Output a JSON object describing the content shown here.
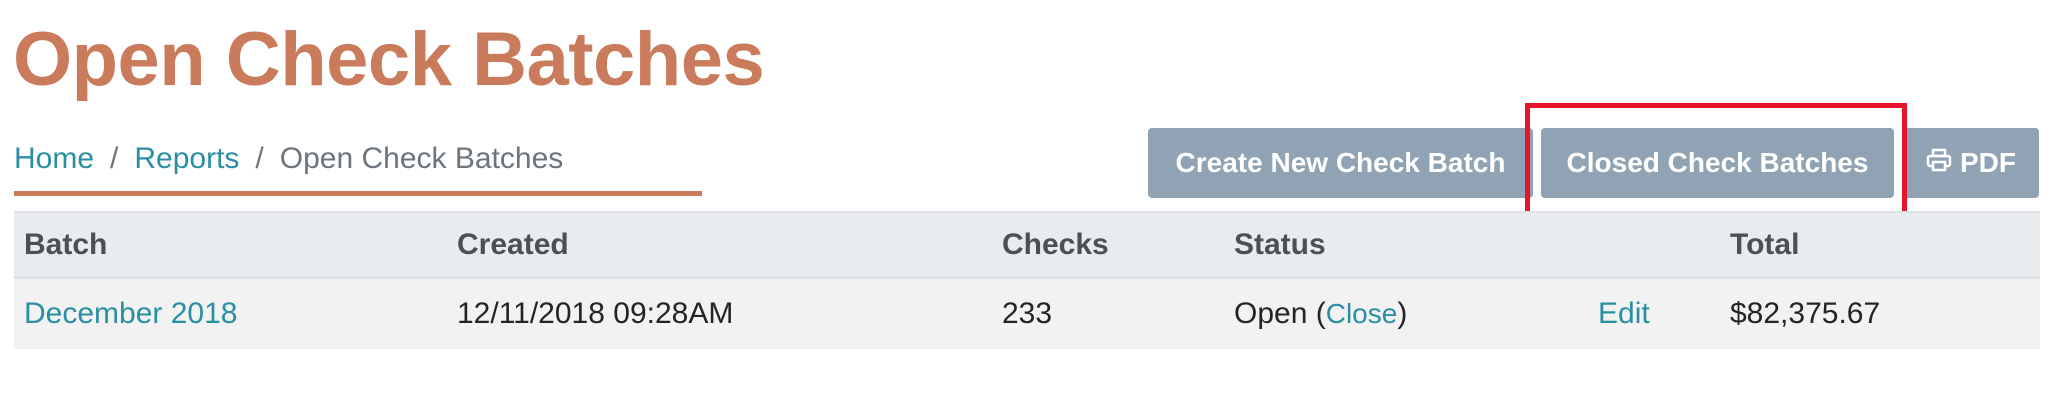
{
  "page": {
    "title": "Open Check Batches"
  },
  "breadcrumb": {
    "items": [
      "Home",
      "Reports",
      "Open Check Batches"
    ],
    "separator": "/"
  },
  "toolbar": {
    "create_label": "Create New Check Batch",
    "closed_label": "Closed Check Batches",
    "pdf_label": "PDF",
    "pdf_icon": "printer-icon"
  },
  "table": {
    "headers": [
      "Batch",
      "Created",
      "Checks",
      "Status",
      "",
      "Total"
    ],
    "rows": [
      {
        "batch": "December 2018",
        "created": "12/11/2018 09:28AM",
        "checks": "233",
        "status": "Open",
        "status_action": "Close",
        "edit": "Edit",
        "total": "$82,375.67"
      }
    ]
  },
  "colors": {
    "title": "#c97b5c",
    "link": "#2a8fa3",
    "button": "#8fa3b5",
    "highlight": "#e8132b"
  }
}
